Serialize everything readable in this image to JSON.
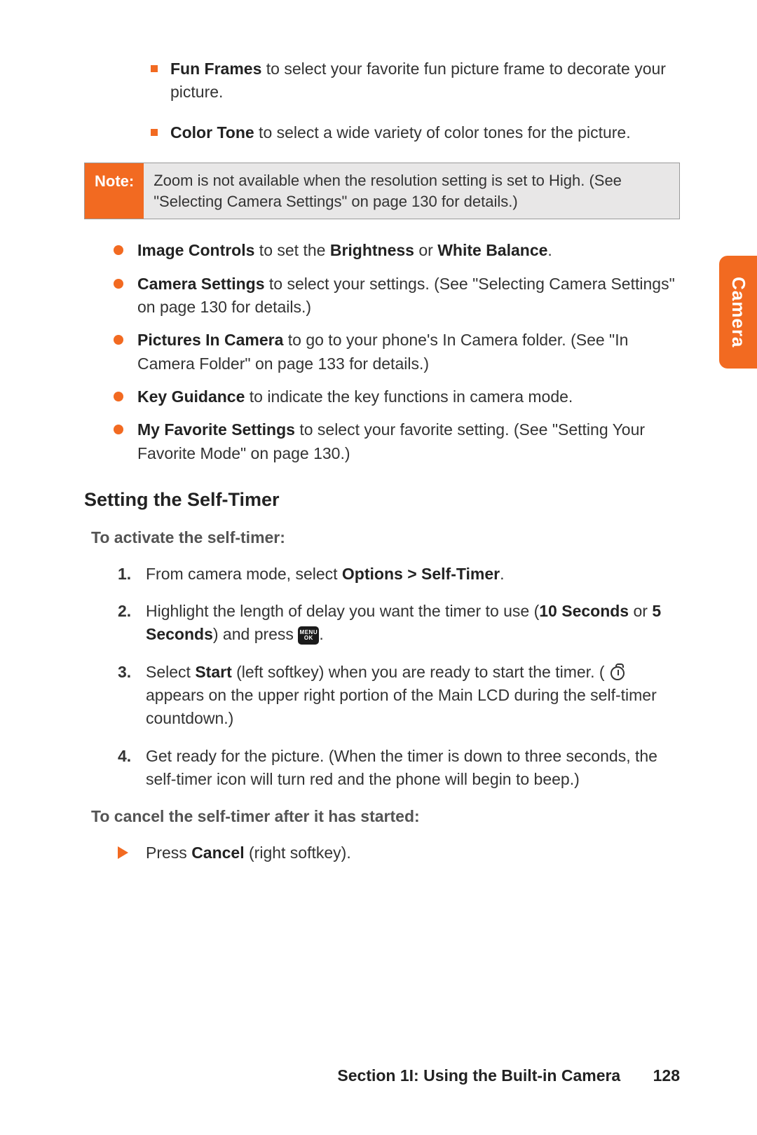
{
  "sideTab": "Camera",
  "topBullets": [
    {
      "bold": "Fun Frames",
      "rest": " to select your favorite fun picture frame to decorate your picture."
    },
    {
      "bold": "Color Tone",
      "rest": " to select a wide variety of color tones for the picture."
    }
  ],
  "note": {
    "label": "Note:",
    "body": "Zoom is not available when the resolution setting is set to High. (See \"Selecting Camera Settings\" on page 130 for details.)"
  },
  "circleBullets": [
    {
      "pre": "",
      "bold": "Image Controls",
      "mid": " to set the ",
      "bold2": "Brightness",
      "mid2": " or ",
      "bold3": "White Balance",
      "end": "."
    },
    {
      "pre": "",
      "bold": "Camera Settings",
      "mid": " to select your settings. (See \"Selecting Camera Settings\" on page 130 for details.)",
      "bold2": "",
      "mid2": "",
      "bold3": "",
      "end": ""
    },
    {
      "pre": "",
      "bold": "Pictures In Camera",
      "mid": " to go to your phone's In Camera folder. (See \"In Camera Folder\" on page 133 for details.)",
      "bold2": "",
      "mid2": "",
      "bold3": "",
      "end": ""
    },
    {
      "pre": "",
      "bold": "Key Guidance",
      "mid": " to indicate the key functions in camera mode.",
      "bold2": "",
      "mid2": "",
      "bold3": "",
      "end": ""
    },
    {
      "pre": "",
      "bold": "My Favorite Settings",
      "mid": " to select your favorite setting. (See \"Setting Your Favorite Mode\" on page 130.)",
      "bold2": "",
      "mid2": "",
      "bold3": "",
      "end": ""
    }
  ],
  "heading": "Setting the Self-Timer",
  "subHeading1": "To activate the self-timer:",
  "steps": {
    "s1_pre": "From camera mode, select ",
    "s1_bold": "Options > Self-Timer",
    "s1_post": ".",
    "s2_pre": "Highlight the length of delay you want the timer to use (",
    "s2_bold1": "10 Seconds",
    "s2_mid": " or ",
    "s2_bold2": "5 Seconds",
    "s2_post1": ") and press ",
    "s2_post2": ".",
    "s3_pre": "Select ",
    "s3_bold": "Start",
    "s3_mid": " (left softkey) when you are ready to start the timer. ( ",
    "s3_post": " appears on the upper right portion of the Main LCD during the self-timer countdown.)",
    "s4": "Get ready for the picture. (When the timer is down to three seconds, the self-timer icon will turn red and the phone will begin to beep.)"
  },
  "subHeading2": "To cancel the self-timer after it has started:",
  "cancel": {
    "pre": "Press ",
    "bold": "Cancel",
    "post": " (right softkey)."
  },
  "menuKey": {
    "top": "MENU",
    "bottom": "OK"
  },
  "footer": {
    "section": "Section 1I: Using the Built-in Camera",
    "page": "128"
  }
}
